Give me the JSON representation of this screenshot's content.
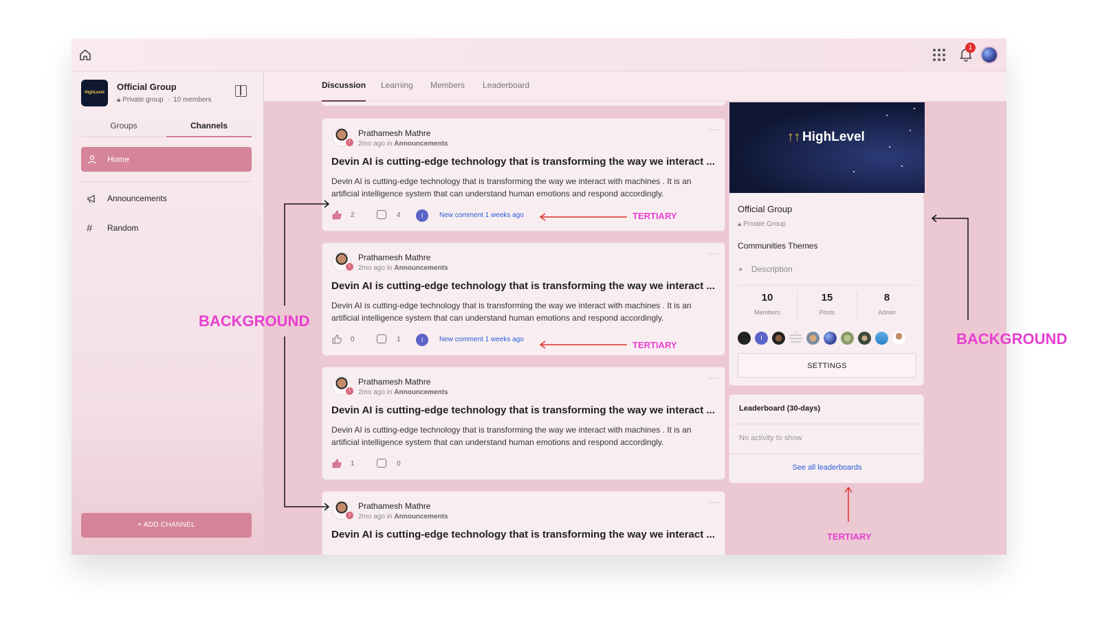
{
  "topbar": {
    "notification_count": "1"
  },
  "sidebar": {
    "group_name": "Official Group",
    "group_logo_text": "HighLevel",
    "group_privacy": "Private group",
    "group_members": "10 members",
    "tabs": [
      {
        "label": "Groups"
      },
      {
        "label": "Channels"
      }
    ],
    "active_tab": "Channels",
    "home_label": "Home",
    "channels": [
      {
        "label": "Announcements",
        "icon": "megaphone-icon"
      },
      {
        "label": "Random",
        "icon": "hash-icon"
      }
    ],
    "add_channel_label": "+ ADD CHANNEL"
  },
  "main_tabs": [
    {
      "label": "Discussion"
    },
    {
      "label": "Learning"
    },
    {
      "label": "Members"
    },
    {
      "label": "Leaderboard"
    }
  ],
  "posts": [
    {
      "author": "Prathamesh Mathre",
      "time": "2mo ago in",
      "channel": "Announcements",
      "title": "Devin AI is cutting-edge technology that is transforming the way we interact ...",
      "body": "Devin AI is cutting-edge technology that is transforming the way we interact with machines . It is an artificial intelligence system that can understand human emotions and respond accordingly.",
      "likes": "2",
      "comments": "4",
      "commenter_initial": "I",
      "new_comment": "New comment 1 weeks ago",
      "liked": true
    },
    {
      "author": "Prathamesh Mathre",
      "time": "2mo ago in",
      "channel": "Announcements",
      "title": "Devin AI is cutting-edge technology that is transforming the way we interact ...",
      "body": "Devin AI is cutting-edge technology that is transforming the way we interact with machines . It is an artificial intelligence system that can understand human emotions and respond accordingly.",
      "likes": "0",
      "comments": "1",
      "commenter_initial": "I",
      "new_comment": "New comment 1 weeks ago",
      "liked": false
    },
    {
      "author": "Prathamesh Mathre",
      "time": "2mo ago in",
      "channel": "Announcements",
      "title": "Devin AI is cutting-edge technology that is transforming the way we interact ...",
      "body": "Devin AI is cutting-edge technology that is transforming the way we interact with machines . It is an artificial intelligence system that can understand human emotions and respond accordingly.",
      "likes": "1",
      "comments": "0",
      "liked": true
    },
    {
      "author": "Prathamesh Mathre",
      "time": "2mo ago in",
      "channel": "Announcements",
      "title": "Devin AI is cutting-edge technology that is transforming the way we interact ...",
      "body": "",
      "liked": false
    }
  ],
  "about": {
    "banner_logo": "HighLevel",
    "title": "Official Group",
    "privacy": "Private Group",
    "themes": "Communities Themes",
    "description": "Description",
    "stats": [
      {
        "value": "10",
        "label": "Members"
      },
      {
        "value": "15",
        "label": "Posts"
      },
      {
        "value": "8",
        "label": "Admin"
      }
    ],
    "member_avatar_initial": "I",
    "settings_label": "SETTINGS"
  },
  "leaderboard": {
    "title": "Leaderboard (30-days)",
    "empty": "No activity to show",
    "link": "See all leaderboards"
  },
  "annotations": {
    "background_left": "BACKGROUND",
    "background_right": "BACKGROUND",
    "tertiary_1": "TERTIARY",
    "tertiary_2": "TERTIARY",
    "tertiary_3": "TERTIARY"
  },
  "colors": {
    "accent": "#d58499",
    "annotation_magenta": "#e83fd0",
    "annotation_arrow": "#e0302c",
    "link_blue": "#2a5bd7",
    "feed_background": "#ecc8d2"
  }
}
